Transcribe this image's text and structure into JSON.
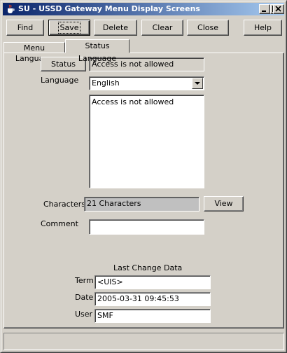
{
  "window": {
    "title": "SU - USSD Gateway Menu Display Screens"
  },
  "toolbar": {
    "find": "Find",
    "save": "Save",
    "delete": "Delete",
    "clear": "Clear",
    "close": "Close",
    "help": "Help"
  },
  "tabs": [
    {
      "label": "Menu Language",
      "selected": false
    },
    {
      "label": "Status Language",
      "selected": true
    }
  ],
  "form": {
    "status_button": "Status",
    "status_value": "Access is not allowed",
    "language_label": "Language",
    "language_value": "English",
    "message_text": "Access is not allowed",
    "characters_label": "Characters",
    "characters_value": "21 Characters",
    "view_button": "View",
    "comment_label": "Comment",
    "comment_value": ""
  },
  "last_change": {
    "heading": "Last Change Data",
    "term_label": "Term",
    "term_value": "<UIS>",
    "date_label": "Date",
    "date_value": "2005-03-31 09:45:53",
    "user_label": "User",
    "user_value": "SMF"
  },
  "status_bar": {
    "text": ""
  },
  "icons": {
    "app": "java-cup-icon",
    "minimize": "minimize-icon",
    "maximize": "maximize-icon",
    "close": "close-icon",
    "dropdown": "chevron-down-icon"
  }
}
